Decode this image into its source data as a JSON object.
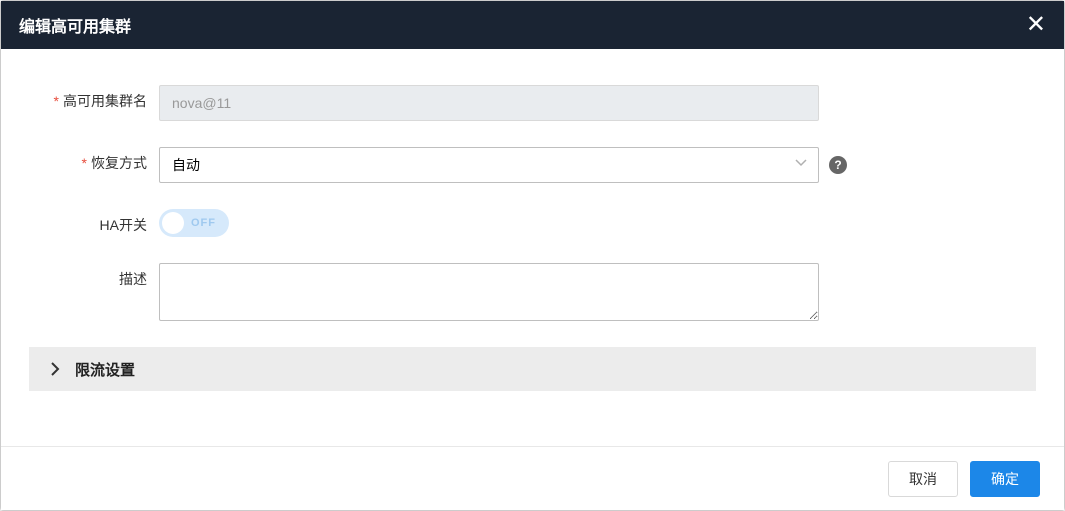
{
  "modal": {
    "title": "编辑高可用集群",
    "close_label": "✕"
  },
  "form": {
    "cluster_name": {
      "label": "高可用集群名",
      "value": "nova@11",
      "required": true
    },
    "recovery_mode": {
      "label": "恢复方式",
      "selected": "自动",
      "required": true
    },
    "ha_switch": {
      "label": "HA开关",
      "state_text": "OFF",
      "value": false
    },
    "description": {
      "label": "描述",
      "value": ""
    }
  },
  "collapse": {
    "rate_limit_title": "限流设置"
  },
  "footer": {
    "cancel": "取消",
    "confirm": "确定"
  },
  "icons": {
    "help": "?"
  }
}
